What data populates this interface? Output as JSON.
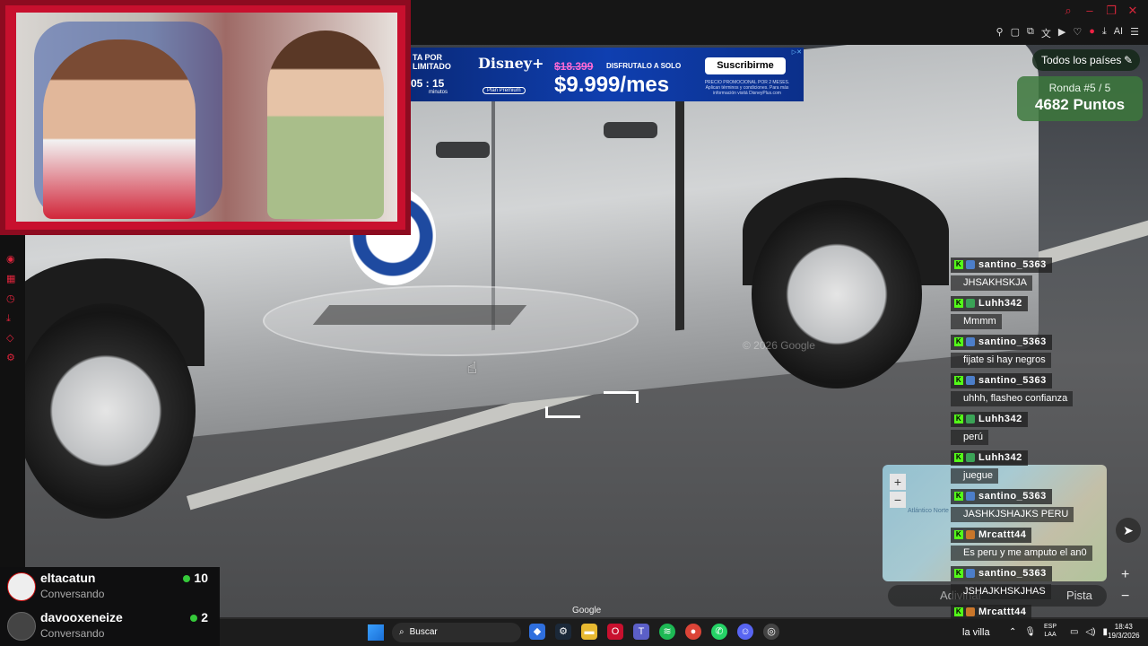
{
  "window": {
    "controls": [
      "⌕",
      "–",
      "❐",
      "✕"
    ],
    "toolbar_icons": [
      "pin-icon",
      "crop-icon",
      "capture-icon",
      "translate-icon",
      "play-icon",
      "heart-icon",
      "user-icon",
      "download-icon",
      "ai-icon",
      "menu-icon"
    ],
    "toolbar_ai_label": "AI"
  },
  "ad": {
    "left_line1": "TA POR",
    "left_line2": "LIMITADO",
    "timer": "05 : 15",
    "timer_label": "minutos",
    "logo": "Disney+",
    "plan": "Plan Premium",
    "old_price": "$18.399",
    "offer": "DISFRUTALO A SOLO",
    "price": "$9.999/mes",
    "fine_print": "PRECIO PROMOCIONAL POR 2 MESES. Aplican términos y condiciones. Para más información visitá DisneyPlus.com",
    "cta": "Suscribirme"
  },
  "game": {
    "country_filter": "Todos los países",
    "round_label": "Ronda #5 / 5",
    "points": "4682 Puntos",
    "watermark": "© 2026 Google",
    "google_label": "Google",
    "guess_label": "Adivinar",
    "hint_label": "Pista",
    "map_label": "Atlántico Norte"
  },
  "chat": [
    {
      "user": "santino_5363",
      "text": "JHSAKHSKJA"
    },
    {
      "user": "Luhh342",
      "text": "Mmmm"
    },
    {
      "user": "santino_5363",
      "text": "fijate si hay negros"
    },
    {
      "user": "santino_5363",
      "text": "uhhh, flasheo confianza"
    },
    {
      "user": "Luhh342",
      "text": "perú"
    },
    {
      "user": "Luhh342",
      "text": "juegue"
    },
    {
      "user": "santino_5363",
      "text": "JASHKJSHAJKS PERU"
    },
    {
      "user": "Mrcattt44",
      "text": "Es peru y me amputo el an0"
    },
    {
      "user": "santino_5363",
      "text": "JSHAJKHSKJHAS"
    },
    {
      "user": "Mrcattt44",
      "text": ""
    }
  ],
  "viewers": [
    {
      "name": "eltacatun",
      "status": "Conversando",
      "count": "10"
    },
    {
      "name": "davooxeneize",
      "status": "Conversando",
      "count": "2"
    }
  ],
  "taskbar": {
    "search_placeholder": "Buscar",
    "weather_label": "la villa",
    "lang_top": "ESP",
    "lang_bottom": "LAA",
    "time": "18:43",
    "date": "19/3/2026"
  }
}
